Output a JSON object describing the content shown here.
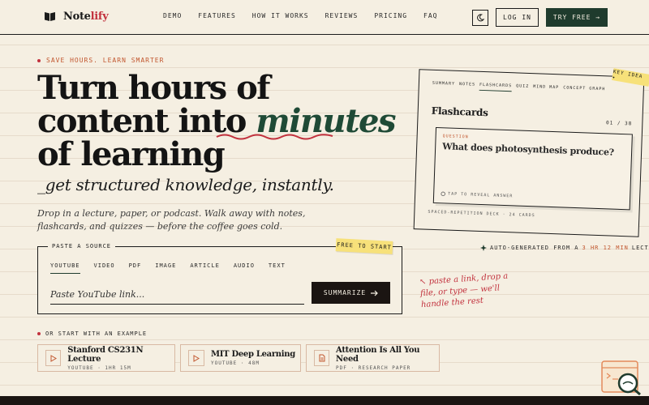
{
  "brand": {
    "name_main": "Note",
    "name_accent": "lify"
  },
  "nav": [
    "DEMO",
    "FEATURES",
    "HOW IT WORKS",
    "REVIEWS",
    "PRICING",
    "FAQ"
  ],
  "header": {
    "login": "LOG IN",
    "try_free": "TRY FREE →"
  },
  "hero": {
    "eyebrow": "SAVE HOURS. LEARN SMARTER",
    "line1": "Turn hours of",
    "line2_pre": "content into ",
    "line2_em": "minutes",
    "line3": "of learning",
    "subhead": "_get structured knowledge, instantly.",
    "lede": "Drop in a lecture, paper, or podcast. Walk away with notes, flashcards, and quizzes — before the coffee goes cold."
  },
  "paste": {
    "label": "PASTE A SOURCE",
    "sticker": "FREE TO START",
    "tabs": [
      "YOUTUBE",
      "VIDEO",
      "PDF",
      "IMAGE",
      "ARTICLE",
      "AUDIO",
      "TEXT"
    ],
    "placeholder": "Paste YouTube link...",
    "button": "SUMMARIZE"
  },
  "examples": {
    "label": "OR START WITH AN EXAMPLE",
    "items": [
      {
        "title": "Stanford CS231N Lecture",
        "meta": "YOUTUBE · 1HR 15M",
        "icon": "play-icon"
      },
      {
        "title": "MIT Deep Learning",
        "meta": "YOUTUBE · 48M",
        "icon": "play-icon"
      },
      {
        "title": "Attention Is All You Need",
        "meta": "PDF · RESEARCH PAPER",
        "icon": "document-icon"
      }
    ]
  },
  "card": {
    "tabs": [
      "SUMMARY",
      "NOTES",
      "FLASHCARDS",
      "QUIZ",
      "MIND MAP",
      "CONCEPT GRAPH"
    ],
    "title": "Flashcards",
    "count": "01 / 38",
    "q_label": "QUESTION",
    "question": "What does photosynthesis produce?",
    "reveal": "TAP TO REVEAL ANSWER",
    "footer": "SPACED-REPETITION DECK · 24 CARDS",
    "key_idea": "KEY IDEA ✦"
  },
  "autogen": {
    "pre": "AUTO-GENERATED FROM A ",
    "hi": "3 HR 12 MIN",
    "post": " LECTURE"
  },
  "scribble": "↖ paste a link, drop a file, or type — we'll handle the rest",
  "colors": {
    "accent_green": "#1f3b2d",
    "accent_red": "#c2323e",
    "paper": "#f5efe2",
    "sticker": "#f7e17a"
  }
}
